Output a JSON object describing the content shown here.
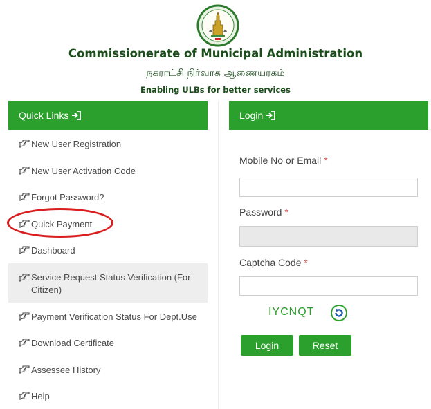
{
  "header": {
    "title": "Commissionerate of Municipal Administration",
    "title_ta": "நகராட்சி நிர்வாக ஆணையரகம்",
    "tagline": "Enabling ULBs for better services"
  },
  "quick_links": {
    "heading": "Quick Links",
    "items": [
      {
        "label": "New User Registration"
      },
      {
        "label": "New User Activation Code"
      },
      {
        "label": "Forgot Password?"
      },
      {
        "label": "Quick Payment"
      },
      {
        "label": "Dashboard"
      },
      {
        "label": "Service Request Status Verification (For Citizen)"
      },
      {
        "label": "Payment Verification Status For Dept.Use"
      },
      {
        "label": "Download Certificate"
      },
      {
        "label": "Assessee History"
      },
      {
        "label": "Help"
      }
    ]
  },
  "login": {
    "heading": "Login",
    "mobile_label": "Mobile No or Email",
    "password_label": "Password",
    "captcha_label": "Captcha Code",
    "required_mark": "*",
    "mobile_value": "",
    "password_value": "",
    "captcha_value": "",
    "captcha_text": "IYCNQT",
    "login_button": "Login",
    "reset_button": "Reset"
  },
  "colors": {
    "accent": "#2ca02c",
    "title": "#1b4d1b",
    "annotation": "#d81e1e"
  },
  "icons": {
    "heading_icon": "sign-in-icon",
    "link_icon": "hand-pointer-icon",
    "refresh_icon": "refresh-icon",
    "emblem": "tamil-nadu-emblem"
  }
}
